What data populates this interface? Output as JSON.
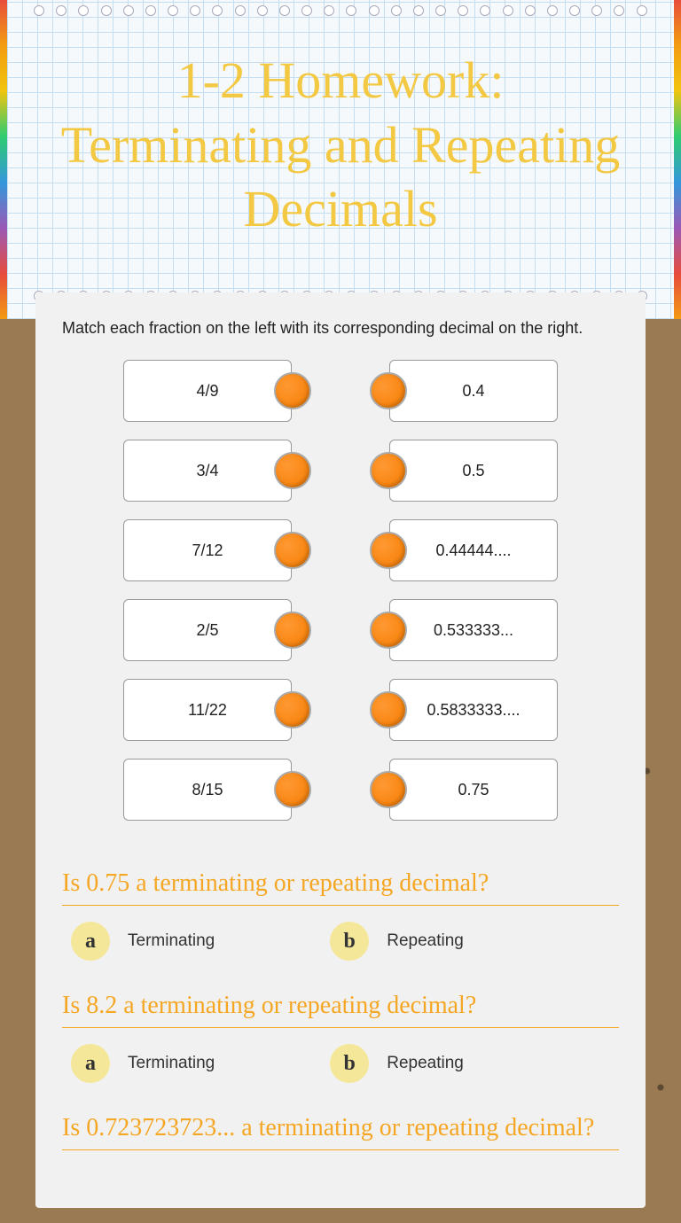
{
  "header": {
    "title": "1-2 Homework: Terminating and Repeating Decimals"
  },
  "match": {
    "instruction": "Match each fraction on the left with its corresponding decimal on the right.",
    "left": [
      "4/9",
      "3/4",
      "7/12",
      "2/5",
      "11/22",
      "8/15"
    ],
    "right": [
      "0.4",
      "0.5",
      "0.44444....",
      "0.533333...",
      "0.5833333....",
      "0.75"
    ]
  },
  "questions": [
    {
      "prompt": "Is 0.75 a terminating or repeating decimal?",
      "options": [
        {
          "letter": "a",
          "label": "Terminating"
        },
        {
          "letter": "b",
          "label": "Repeating"
        }
      ]
    },
    {
      "prompt": "Is 8.2 a terminating or repeating decimal?",
      "options": [
        {
          "letter": "a",
          "label": "Terminating"
        },
        {
          "letter": "b",
          "label": "Repeating"
        }
      ]
    },
    {
      "prompt": "Is 0.723723723... a terminating or repeating decimal?",
      "options": []
    }
  ]
}
